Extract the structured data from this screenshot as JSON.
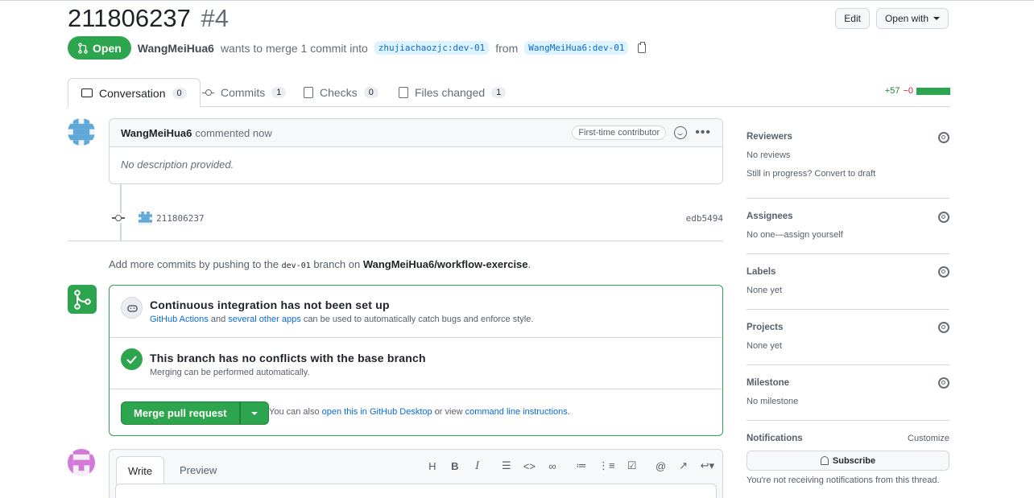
{
  "header": {
    "title": "211806237",
    "number": "#4",
    "edit_label": "Edit",
    "open_with_label": "Open with"
  },
  "meta": {
    "state": "Open",
    "author": "WangMeiHua6",
    "text_mid": "wants to merge 1 commit into",
    "base_branch": "zhujiachaozjc:dev-01",
    "from_label": "from",
    "head_branch": "WangMeiHua6:dev-01"
  },
  "tabs": [
    {
      "label": "Conversation",
      "count": "0"
    },
    {
      "label": "Commits",
      "count": "1"
    },
    {
      "label": "Checks",
      "count": "0"
    },
    {
      "label": "Files changed",
      "count": "1"
    }
  ],
  "diffstat": {
    "additions": "+57",
    "deletions": "−0"
  },
  "comment": {
    "author": "WangMeiHua6",
    "action": "commented now",
    "badge": "First-time contributor",
    "body": "No description provided."
  },
  "commit": {
    "message": "211806237",
    "sha": "edb5494"
  },
  "push_hint": {
    "prefix": "Add more commits by pushing to the",
    "branch": "dev-01",
    "mid": "branch on",
    "repo": "WangMeiHua6/workflow-exercise",
    "suffix": "."
  },
  "merge_box": {
    "ci_title": "Continuous integration has not been set up",
    "ci_link1": "GitHub Actions",
    "ci_and": "and",
    "ci_link2": "several other apps",
    "ci_rest": "can be used to automatically catch bugs and enforce style.",
    "conflict_title": "This branch has no conflicts with the base branch",
    "conflict_sub": "Merging can be performed automatically.",
    "merge_button": "Merge pull request",
    "alt_prefix": "You can also",
    "alt_link1": "open this in GitHub Desktop",
    "alt_mid": "or view",
    "alt_link2": "command line instructions",
    "alt_suffix": "."
  },
  "editor": {
    "write_tab": "Write",
    "preview_tab": "Preview",
    "tools": [
      "H",
      "B",
      "I",
      "quote",
      "code",
      "link",
      "ul",
      "ol",
      "task",
      "@",
      "ref",
      "reply"
    ]
  },
  "sidebar": {
    "reviewers": {
      "title": "Reviewers",
      "value": "No reviews",
      "extra": "Still in progress? Convert to draft"
    },
    "assignees": {
      "title": "Assignees",
      "value": "No one—assign yourself"
    },
    "labels": {
      "title": "Labels",
      "value": "None yet"
    },
    "projects": {
      "title": "Projects",
      "value": "None yet"
    },
    "milestone": {
      "title": "Milestone",
      "value": "No milestone"
    },
    "notifications": {
      "title": "Notifications",
      "customize": "Customize",
      "subscribe": "Subscribe",
      "note": "You're not receiving notifications from this thread."
    }
  },
  "colors": {
    "accent_green": "#2da44e",
    "link_blue": "#0969da",
    "avatar_blue": "#5fa8d8",
    "avatar_pink": "#d27ad8"
  }
}
